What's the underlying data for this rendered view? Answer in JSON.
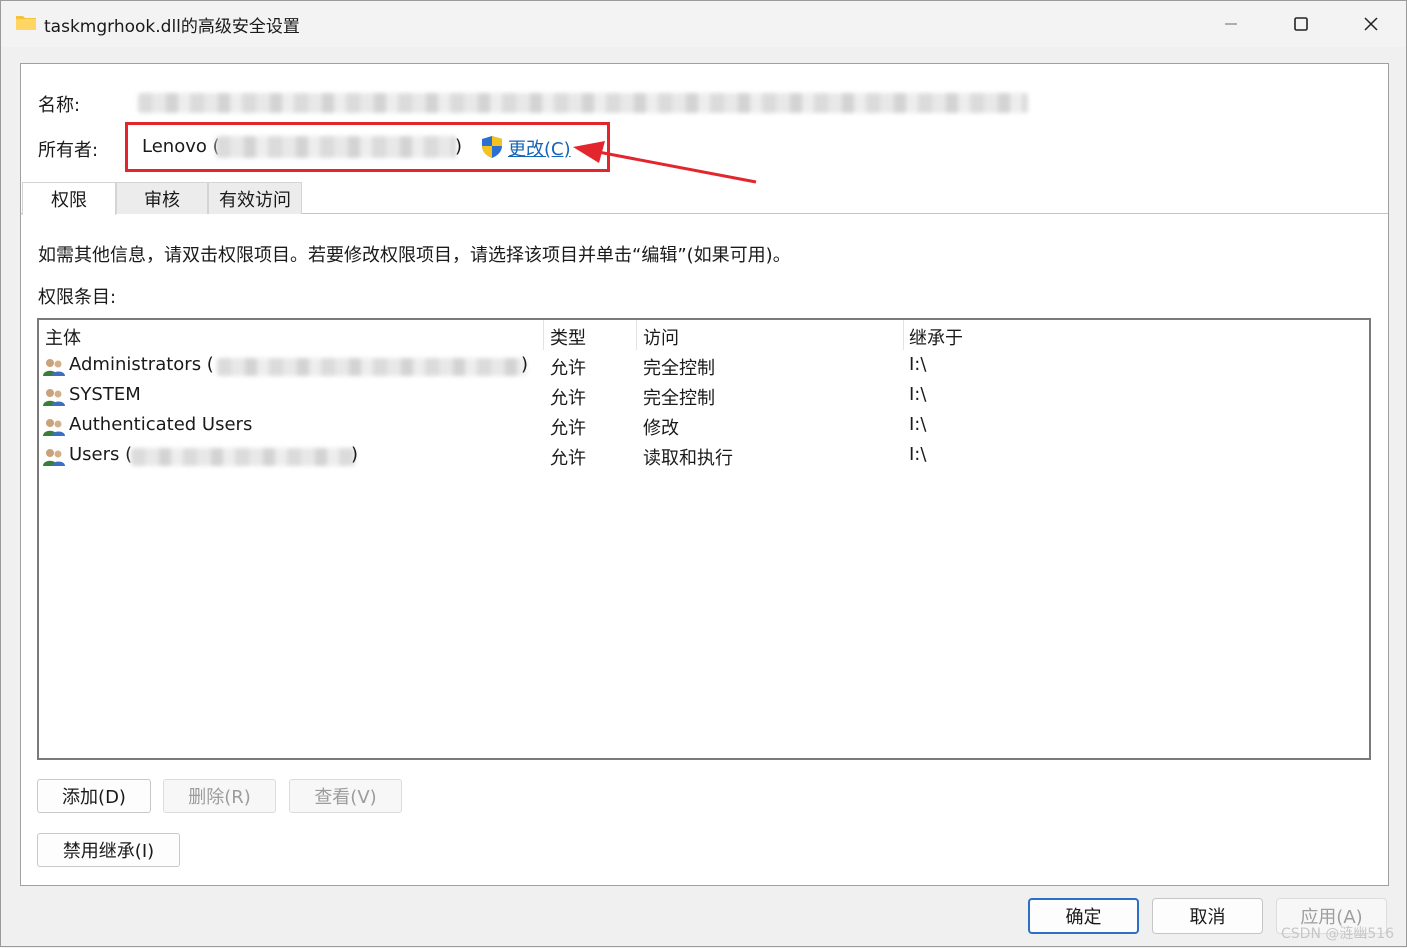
{
  "window": {
    "title": "taskmgrhook.dll的高级安全设置"
  },
  "name_row": {
    "label": "名称:"
  },
  "owner_row": {
    "label": "所有者:",
    "value_prefix": "Lenovo (",
    "value_suffix": ")",
    "change_link": "更改(C)"
  },
  "tabs": [
    {
      "label": "权限"
    },
    {
      "label": "审核"
    },
    {
      "label": "有效访问"
    }
  ],
  "info_text": "如需其他信息，请双击权限项目。若要修改权限项目，请选择该项目并单击“编辑”(如果可用)。",
  "entries_label": "权限条目:",
  "table": {
    "headers": [
      "主体",
      "类型",
      "访问",
      "继承于"
    ],
    "rows": [
      {
        "principal": "Administrators (",
        "suffix": ")",
        "type": "允许",
        "access": "完全控制",
        "inherited": "I:\\"
      },
      {
        "principal": "SYSTEM",
        "suffix": "",
        "type": "允许",
        "access": "完全控制",
        "inherited": "I:\\"
      },
      {
        "principal": "Authenticated Users",
        "suffix": "",
        "type": "允许",
        "access": "修改",
        "inherited": "I:\\"
      },
      {
        "principal": "Users (",
        "suffix": ")",
        "type": "允许",
        "access": "读取和执行",
        "inherited": "I:\\"
      }
    ]
  },
  "buttons": {
    "add": "添加(D)",
    "remove": "删除(R)",
    "view": "查看(V)",
    "disable_inheritance": "禁用继承(I)"
  },
  "footer": {
    "ok": "确定",
    "cancel": "取消",
    "apply": "应用(A)"
  },
  "watermark": "CSDN @涟幽516",
  "colors": {
    "annotation_red": "#e3262e",
    "link_blue": "#1664b8",
    "default_button_border": "#2b6fc7"
  },
  "icons": [
    "folder-icon",
    "minimize-icon",
    "maximize-icon",
    "close-icon",
    "uac-shield-icon",
    "users-icon"
  ]
}
